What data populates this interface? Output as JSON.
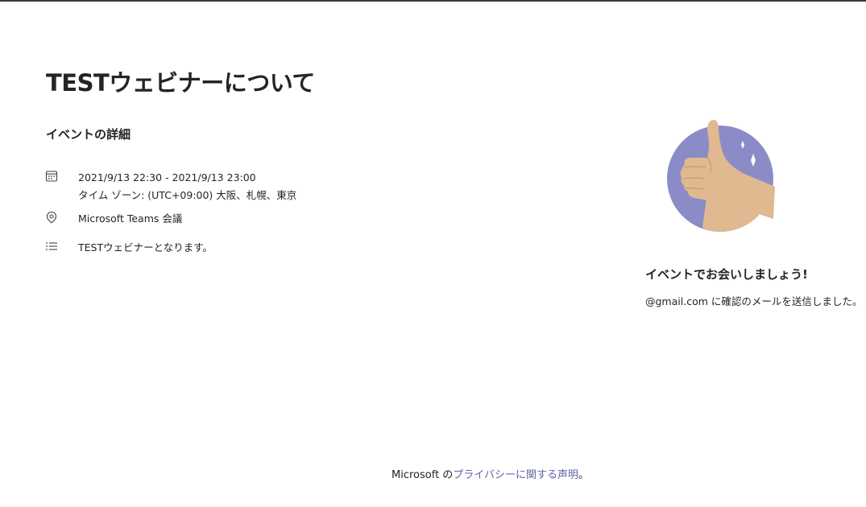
{
  "header": {
    "title": "TESTウェビナーについて"
  },
  "details": {
    "section_title": "イベントの詳細",
    "date_range": "2021/9/13 22:30 - 2021/9/13 23:00",
    "timezone": "タイム ゾーン: (UTC+09:00) 大阪、札幌、東京",
    "location": "Microsoft Teams 会議",
    "description": "TESTウェビナーとなります。",
    "icons": {
      "date": "calendar-icon",
      "location": "location-pin-icon",
      "description": "list-icon"
    }
  },
  "confirmation": {
    "title": "イベントでお会いしましょう!",
    "message": "@gmail.com に確認のメールを送信しました。",
    "illustration": "thumbs-up-illustration"
  },
  "footer": {
    "prefix": "Microsoft の",
    "link_text": "プライバシーに関する声明",
    "suffix": "。"
  },
  "colors": {
    "accent": "#6264a7",
    "text": "#242424",
    "illustration_circle": "#8b8cc7",
    "skin": "#e0b990"
  }
}
